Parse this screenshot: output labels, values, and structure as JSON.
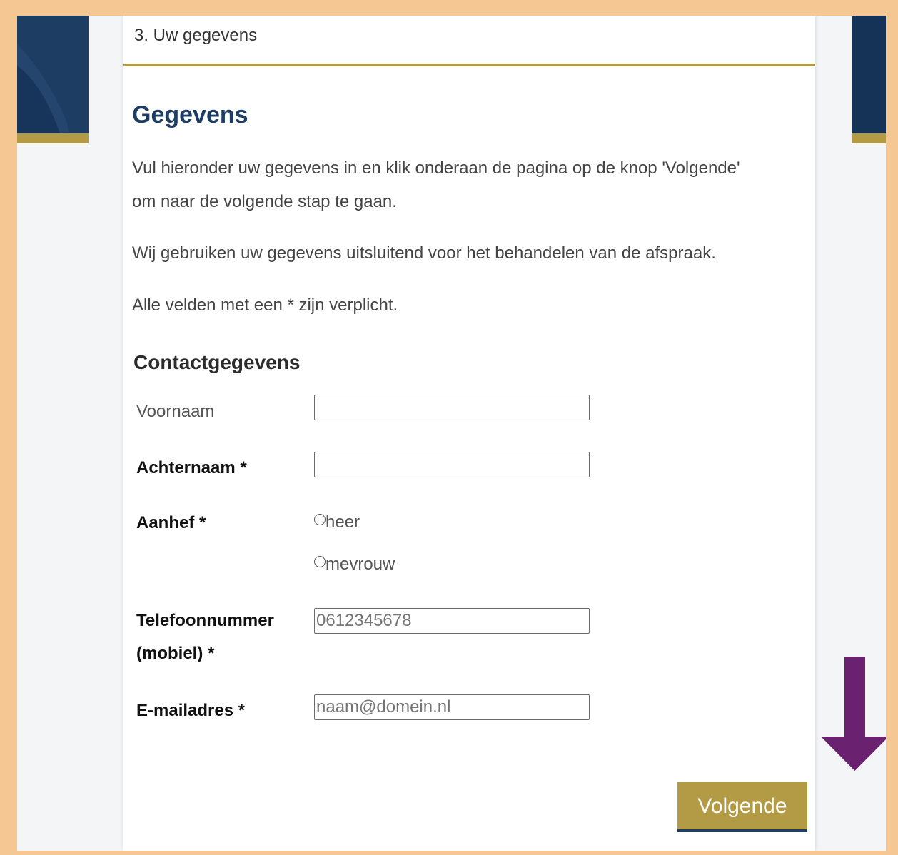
{
  "step": {
    "label": "3. Uw gegevens"
  },
  "heading": "Gegevens",
  "intro": {
    "line1": "Vul hieronder uw gegevens in en klik onderaan de pagina op de knop 'Volgende'",
    "line2": "om naar de volgende stap te gaan.",
    "privacy": "Wij gebruiken uw gegevens uitsluitend voor het behandelen van de afspraak.",
    "required_note": "Alle velden met een * zijn verplicht."
  },
  "section": {
    "title": "Contactgegevens"
  },
  "form": {
    "voornaam": {
      "label": "Voornaam",
      "value": ""
    },
    "achternaam": {
      "label": "Achternaam *",
      "value": ""
    },
    "aanhef": {
      "label": "Aanhef *",
      "options": [
        "heer",
        "mevrouw"
      ]
    },
    "telefoon": {
      "label_line1": "Telefoonnummer",
      "label_line2": "(mobiel) *",
      "placeholder": "0612345678"
    },
    "email": {
      "label": "E-mailadres *",
      "placeholder": "naam@domein.nl"
    }
  },
  "actions": {
    "next_label": "Volgende"
  },
  "colors": {
    "navy": "#1d3d63",
    "gold": "#b39a45",
    "arrow": "#6a2170",
    "frame": "#f5c893"
  }
}
